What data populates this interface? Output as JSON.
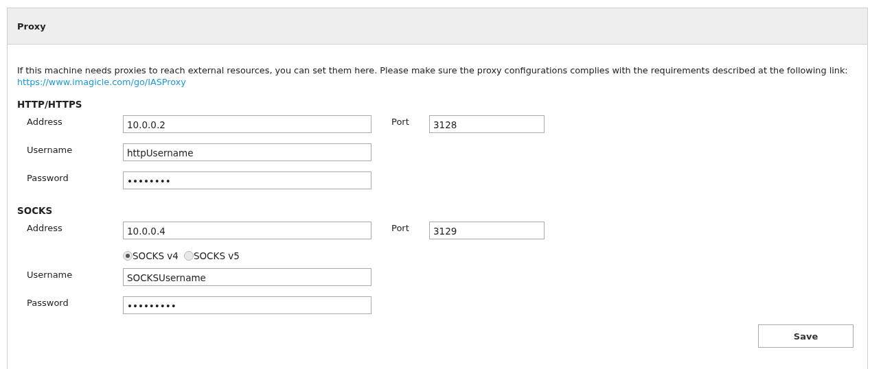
{
  "panel": {
    "title": "Proxy"
  },
  "intro": {
    "text": "If this machine needs proxies to reach external resources, you can set them here. Please make sure the proxy configurations complies with the requirements described at the following link:",
    "link": "https://www.imagicle.com/go/IASProxy"
  },
  "sections": [
    {
      "title": "HTTP/HTTPS",
      "address_label": "Address",
      "address": "10.0.0.2",
      "port_label": "Port",
      "port": "3128",
      "username_label": "Username",
      "username": "httpUsername",
      "password_label": "Password",
      "password": "••••••••"
    },
    {
      "title": "SOCKS",
      "address_label": "Address",
      "address": "10.0.0.4",
      "port_label": "Port",
      "port": "3129",
      "versions": [
        {
          "label": "SOCKS v4",
          "selected": true
        },
        {
          "label": "SOCKS v5",
          "selected": false
        }
      ],
      "username_label": "Username",
      "username": "SOCKSUsername",
      "password_label": "Password",
      "password": "•••••••••"
    }
  ],
  "save_button": "Save"
}
